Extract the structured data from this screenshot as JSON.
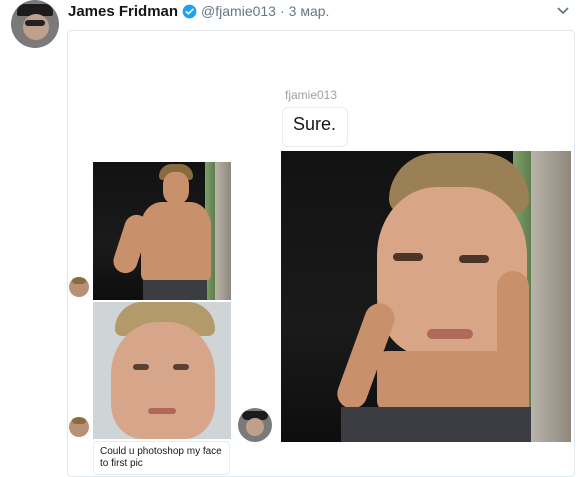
{
  "tweet": {
    "author_name": "James Fridman",
    "verified_icon": "verified-badge-icon",
    "handle": "@fjamie013",
    "dot": "·",
    "date": "3 мар.",
    "chevron_icon": "chevron-down-icon"
  },
  "chat": {
    "reply_sender": "fjamie013",
    "reply_text": "Sure.",
    "request_text": "Could u photoshop my face to first pic"
  },
  "colors": {
    "verified": "#1da1f2",
    "meta_text": "#657786",
    "border": "#e1e8ed"
  }
}
